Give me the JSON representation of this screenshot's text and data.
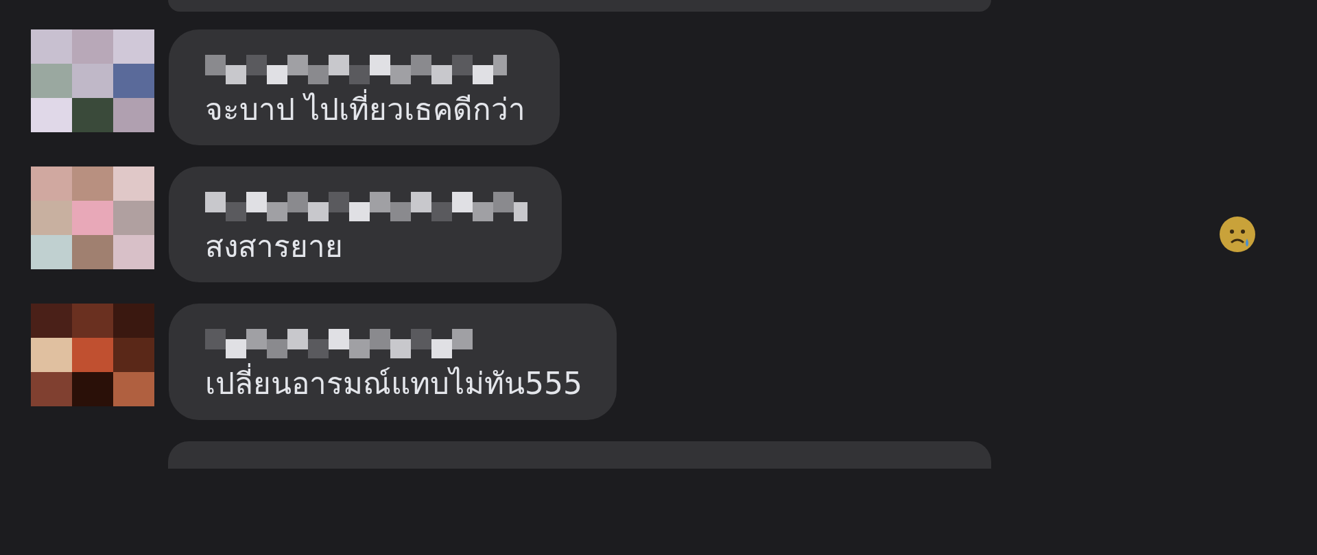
{
  "comments": [
    {
      "text": "จะบาป ไปเที่ยวเธคดีกว่า"
    },
    {
      "text": "สงสารยาย"
    },
    {
      "text": "เปลี่ยนอารมณ์แทบไม่ทัน555"
    }
  ]
}
